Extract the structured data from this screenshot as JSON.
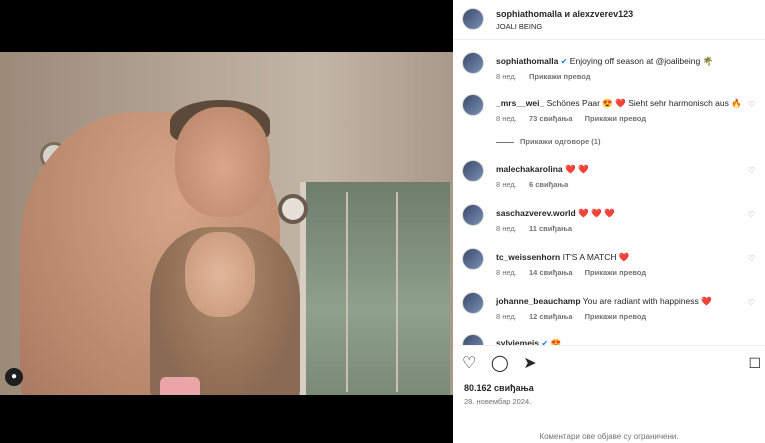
{
  "header": {
    "names": "sophiathomalla и alexzverev123",
    "location": "JOALI BEING"
  },
  "caption": {
    "username": "sophiathomalla",
    "text": "Enjoying off season at @joalibeing 🌴",
    "age": "8 нед.",
    "translate": "Прикажи превод"
  },
  "comments": [
    {
      "username": "_mrs__wei_",
      "text": "Schönes Paar 😍 ❤️ Sieht sehr harmonisch aus 🔥",
      "age": "8 нед.",
      "likes": "73 свиђања",
      "translate": "Прикажи превод",
      "replies": "Прикажи одговоре (1)"
    },
    {
      "username": "malechakarolina",
      "text": "❤️ ❤️",
      "age": "8 нед.",
      "likes": "6 свиђања"
    },
    {
      "username": "saschazverev.world",
      "text": "❤️ ❤️ ❤️",
      "age": "8 нед.",
      "likes": "11 свиђања"
    },
    {
      "username": "tc_weissenhorn",
      "text": "IT'S A MATCH ❤️",
      "age": "8 нед.",
      "likes": "14 свиђања",
      "translate": "Прикажи превод"
    },
    {
      "username": "johanne_beauchamp",
      "text": "You are radiant with happiness ❤️",
      "age": "8 нед.",
      "likes": "12 свиђања",
      "translate": "Прикажи превод"
    },
    {
      "username": "sylviemeis",
      "text": "😍"
    }
  ],
  "icons": {
    "like": "heart-outline-icon",
    "comment": "comment-bubble-icon",
    "share": "paper-plane-icon",
    "save": "bookmark-icon",
    "tag": "user-tag-icon"
  },
  "post": {
    "likes": "80.162 свиђања",
    "date": "28. новембар 2024.",
    "comments_limited": "Коментари ове објаве су ограничени."
  }
}
